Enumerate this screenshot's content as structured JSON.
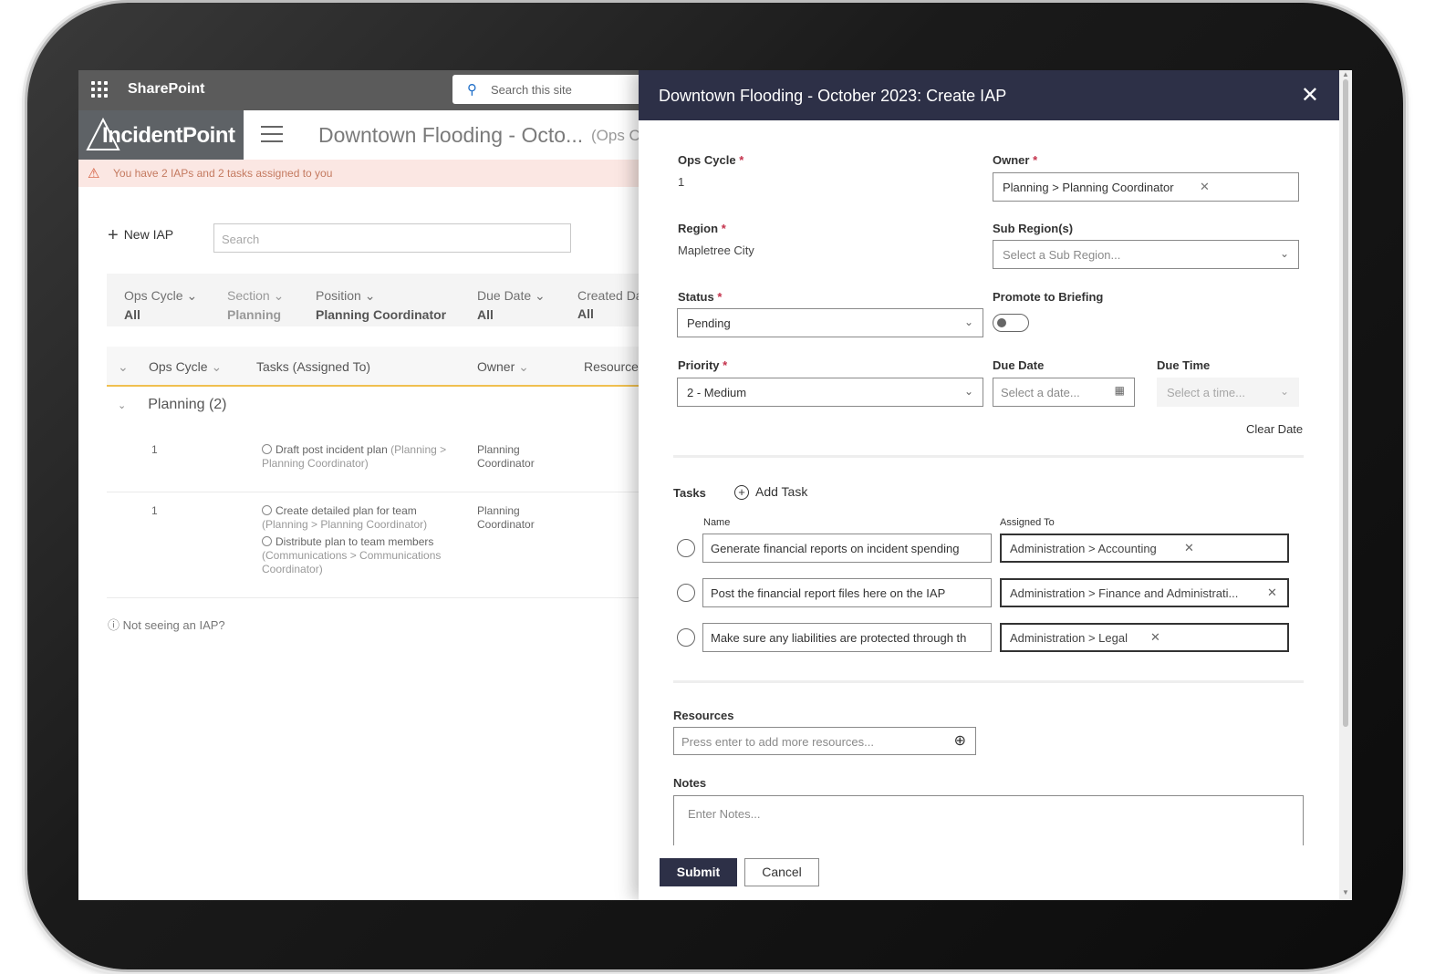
{
  "sharepoint": {
    "app_name": "SharePoint",
    "search_placeholder": "Search this site"
  },
  "site": {
    "logo_text": "IncidentPoint",
    "page_title": "Downtown Flooding - Octo...",
    "page_subtitle": "(Ops C",
    "alert": "You have 2 IAPs and 2 tasks assigned to you"
  },
  "list": {
    "new_iap_label": "New IAP",
    "search_placeholder": "Search",
    "filters": [
      {
        "label": "Ops Cycle",
        "value": "All"
      },
      {
        "label": "Section",
        "value": "Planning"
      },
      {
        "label": "Position",
        "value": "Planning Coordinator"
      },
      {
        "label": "Due Date",
        "value": "All"
      },
      {
        "label": "Created Da",
        "value": "All"
      }
    ],
    "columns": [
      "Ops Cycle",
      "Tasks (Assigned To)",
      "Owner",
      "Resources"
    ],
    "group_label": "Planning (2)",
    "rows": [
      {
        "ops_cycle": "1",
        "tasks": [
          {
            "name": "Draft post incident plan",
            "assigned": "(Planning > Planning Coordinator)"
          }
        ],
        "owner": "Planning Coordinator"
      },
      {
        "ops_cycle": "1",
        "tasks": [
          {
            "name": "Create detailed plan for team",
            "assigned": "(Planning > Planning Coordinator)"
          },
          {
            "name": "Distribute plan to team members",
            "assigned": "(Communications > Communications Coordinator)"
          }
        ],
        "owner": "Planning Coordinator"
      }
    ],
    "not_seeing": "Not seeing an IAP?"
  },
  "panel": {
    "title": "Downtown Flooding - October 2023: Create IAP",
    "ops_cycle_label": "Ops Cycle",
    "ops_cycle_value": "1",
    "owner_label": "Owner",
    "owner_value": "Planning > Planning Coordinator",
    "region_label": "Region",
    "region_value": "Mapletree City",
    "subregion_label": "Sub Region(s)",
    "subregion_placeholder": "Select a Sub Region...",
    "status_label": "Status",
    "status_value": "Pending",
    "promote_label": "Promote to Briefing",
    "promote_on": false,
    "priority_label": "Priority",
    "priority_value": "2 - Medium",
    "due_date_label": "Due Date",
    "due_date_placeholder": "Select a date...",
    "due_time_label": "Due Time",
    "due_time_placeholder": "Select a time...",
    "clear_date": "Clear Date",
    "tasks_label": "Tasks",
    "add_task": "Add Task",
    "name_col": "Name",
    "assigned_col": "Assigned To",
    "tasks": [
      {
        "name": "Generate financial reports on incident spending",
        "assigned": "Administration > Accounting"
      },
      {
        "name": "Post the financial report files here on the IAP",
        "assigned": "Administration > Finance and Administrati..."
      },
      {
        "name": "Make sure any liabilities are protected through th",
        "assigned": "Administration > Legal"
      }
    ],
    "resources_label": "Resources",
    "resources_placeholder": "Press enter to add more resources...",
    "notes_label": "Notes",
    "notes_placeholder": "Enter Notes...",
    "submit": "Submit",
    "cancel": "Cancel"
  }
}
